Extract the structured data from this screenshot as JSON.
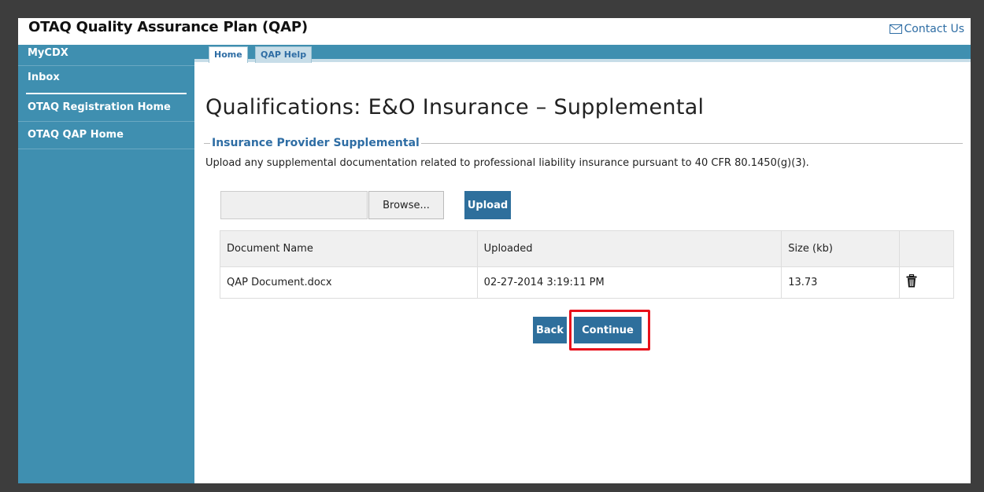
{
  "header": {
    "title": "OTAQ Quality Assurance Plan (QAP)",
    "contact_label": "Contact Us"
  },
  "sidebar": {
    "items": [
      {
        "label": "MyCDX"
      },
      {
        "label": "Inbox"
      },
      {
        "label": "OTAQ Registration Home"
      },
      {
        "label": "OTAQ QAP Home"
      }
    ]
  },
  "tabs": [
    {
      "label": "Home",
      "active": true
    },
    {
      "label": "QAP Help",
      "active": false
    }
  ],
  "page": {
    "title": "Qualifications: E&O Insurance – Supplemental",
    "section_label": "Insurance Provider Supplemental",
    "description": "Upload any supplemental documentation related to professional liability insurance pursuant to 40 CFR 80.1450(g)(3)."
  },
  "upload": {
    "file_value": "",
    "browse_label": "Browse...",
    "upload_label": "Upload"
  },
  "table": {
    "headers": [
      "Document Name",
      "Uploaded",
      "Size (kb)",
      ""
    ],
    "rows": [
      {
        "name": "QAP Document.docx",
        "uploaded": "02-27-2014 3:19:11 PM",
        "size": "13.73",
        "action_icon": "trash-icon"
      }
    ]
  },
  "actions": {
    "back_label": "Back",
    "continue_label": "Continue"
  },
  "colors": {
    "sidebar": "#3f8fb0",
    "button": "#2e6f9c",
    "accent": "#2e6da4",
    "highlight": "#e8101a",
    "frame": "#3d3d3d"
  }
}
